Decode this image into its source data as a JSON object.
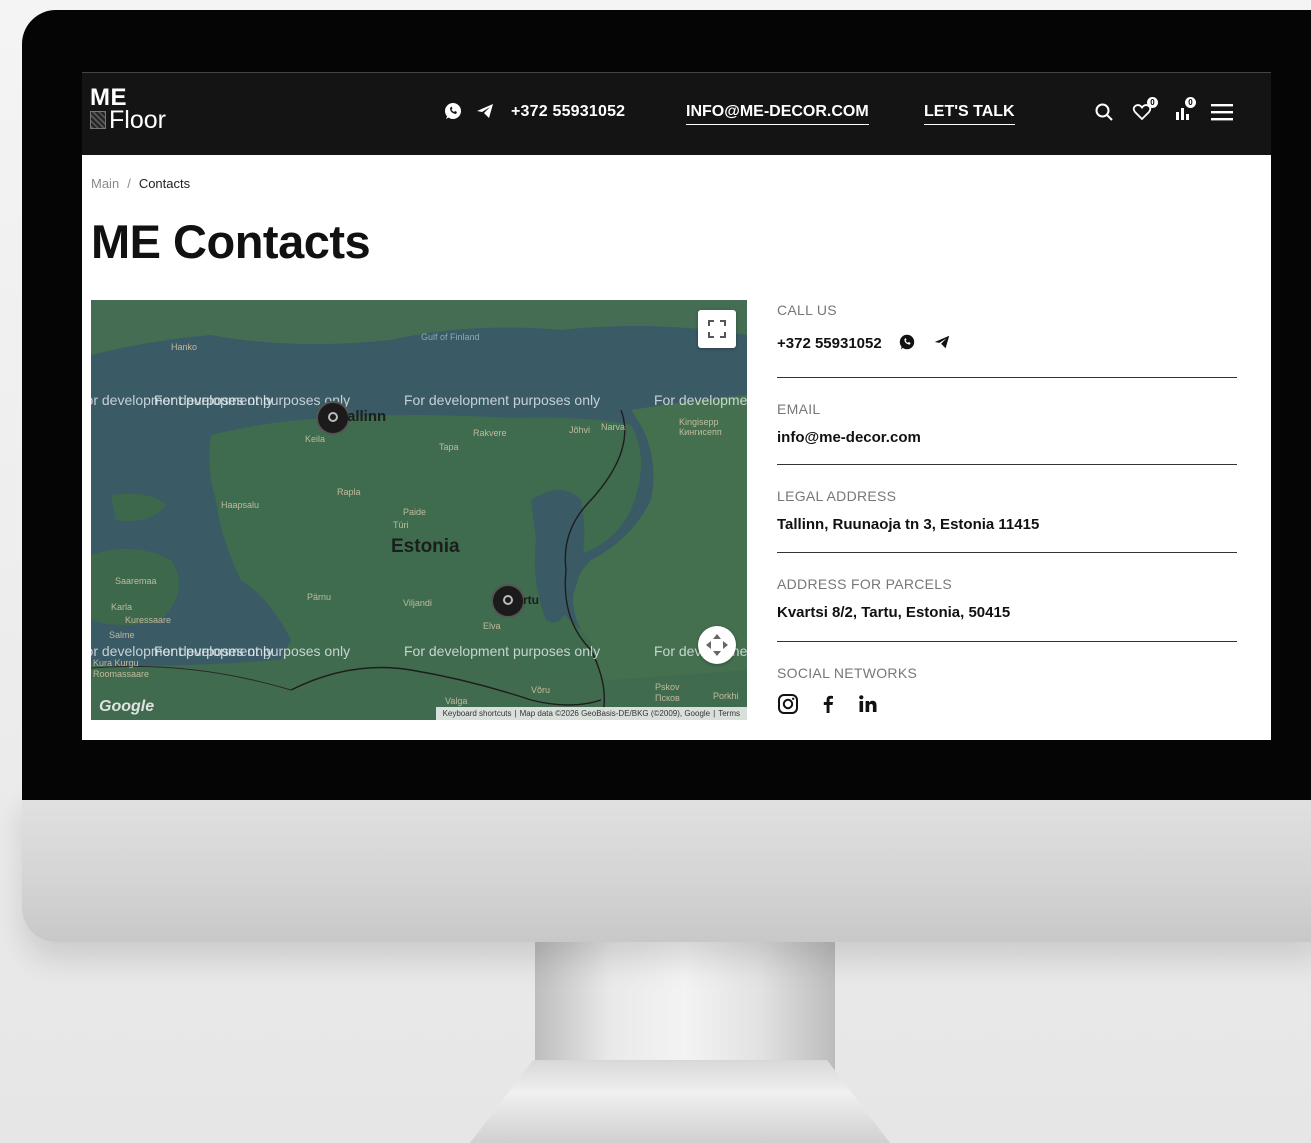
{
  "header": {
    "logo_line1": "ME",
    "logo_line2": "Floor",
    "phone": "+372 55931052",
    "email_link": "INFO@ME-DECOR.COM",
    "talk_link": "LET'S TALK",
    "favorites_count": "0",
    "cart_count": "0"
  },
  "breadcrumb": {
    "home": "Main",
    "separator": "/",
    "current": "Contacts"
  },
  "page_title": "ME Contacts",
  "map": {
    "country_label": "Estonia",
    "dev_watermark": "For development purposes only",
    "places": {
      "hanko": "Hanko",
      "gulf": "Gulf of Finland",
      "tallinn": "allinn",
      "keila": "Keila",
      "rakvere": "Rakvere",
      "johvi": "Jõhvi",
      "narva": "Narva",
      "kingisepp": "Kingisepp",
      "kingisepp_ru": "Кингисепп",
      "tapa": "Tapa",
      "haapsalu": "Haapsalu",
      "rapla": "Rapla",
      "paide": "Paide",
      "turi": "Türi",
      "saaremaa": "Saaremaa",
      "parnu": "Pärnu",
      "viljandi": "Viljandi",
      "tartu": "rtu",
      "elva": "Elva",
      "karla": "Karla",
      "kuressaare": "Kuressaare",
      "salme": "Salme",
      "kura": "Kura Kurgu",
      "ruhnu": "Roomassaare",
      "valga": "Valga",
      "voru": "Võru",
      "pskov": "Pskov",
      "pskov_ru": "Псков",
      "porkhov": "Porkhi"
    },
    "attribution": [
      "Keyboard shortcuts",
      "Map data ©2026 GeoBasis-DE/BKG (©2009), Google",
      "Terms"
    ],
    "google_logo": "Google"
  },
  "contacts": {
    "call_label": "CALL US",
    "call_value": "+372 55931052",
    "email_label": "EMAIL",
    "email_value": "info@me-decor.com",
    "legal_label": "LEGAL ADDRESS",
    "legal_value": "Tallinn, Ruunaoja tn 3, Estonia 11415",
    "parcels_label": "ADDRESS FOR PARCELS",
    "parcels_value": "Kvartsi 8/2, Tartu, Estonia, 50415",
    "social_label": "SOCIAL NETWORKS",
    "social_icons": [
      "instagram-icon",
      "facebook-icon",
      "linkedin-icon"
    ]
  },
  "colors": {
    "header_bg": "#141414",
    "map_water": "#3a5a66",
    "map_land": "#3f6b4e",
    "text_dark": "#111111",
    "muted": "#777777"
  }
}
